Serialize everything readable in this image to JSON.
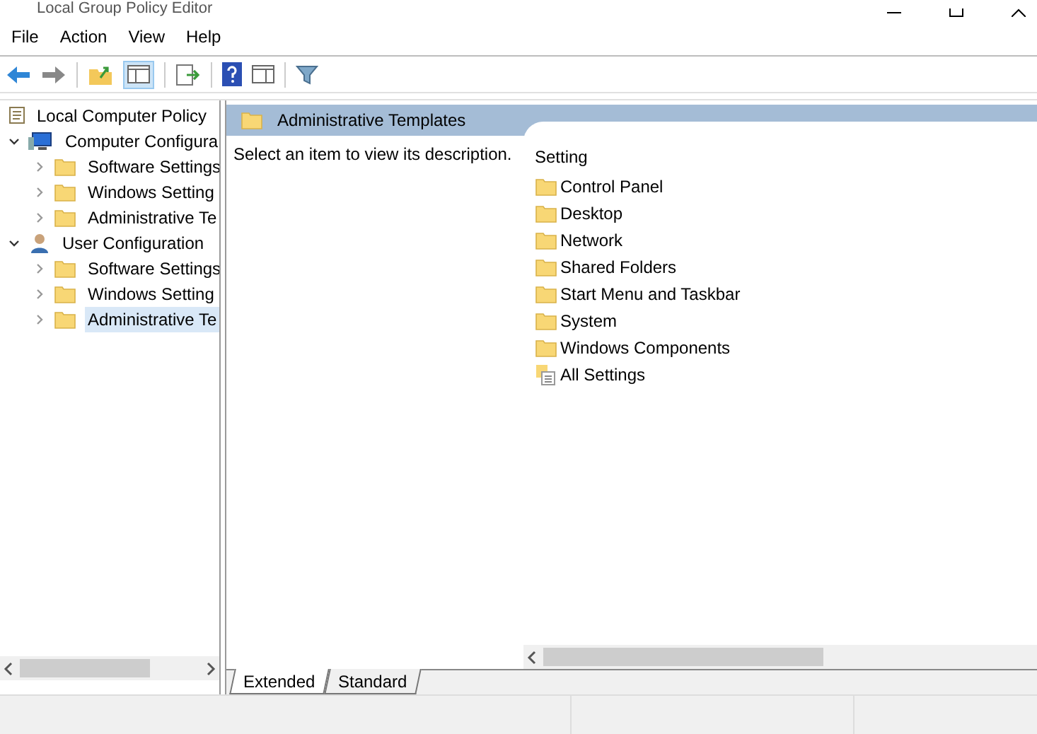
{
  "window": {
    "title": "Local Group Policy Editor"
  },
  "menu": [
    "File",
    "Action",
    "View",
    "Help"
  ],
  "tree": [
    {
      "label": "Local Computer Policy",
      "kind": "policy",
      "selected": false,
      "children": [
        {
          "label": "Computer Configura",
          "kind": "computer",
          "expanded": true,
          "selected": false,
          "children": [
            {
              "label": "Software Settings",
              "kind": "folder",
              "expanded": false,
              "selected": false
            },
            {
              "label": "Windows Setting",
              "kind": "folder",
              "expanded": false,
              "selected": false
            },
            {
              "label": "Administrative Te",
              "kind": "folder",
              "expanded": false,
              "selected": false
            }
          ]
        },
        {
          "label": "User Configuration",
          "kind": "user",
          "expanded": true,
          "selected": false,
          "children": [
            {
              "label": "Software Settings",
              "kind": "folder",
              "expanded": false,
              "selected": false
            },
            {
              "label": "Windows Setting",
              "kind": "folder",
              "expanded": false,
              "selected": false
            },
            {
              "label": "Administrative Te",
              "kind": "folder",
              "expanded": false,
              "selected": true
            }
          ]
        }
      ]
    }
  ],
  "header": {
    "title": "Administrative Templates"
  },
  "description": "Select an item to view its description.",
  "list": {
    "column": "Setting",
    "items": [
      {
        "label": "Control Panel",
        "kind": "folder"
      },
      {
        "label": "Desktop",
        "kind": "folder"
      },
      {
        "label": "Network",
        "kind": "folder"
      },
      {
        "label": "Shared Folders",
        "kind": "folder"
      },
      {
        "label": "Start Menu and Taskbar",
        "kind": "folder"
      },
      {
        "label": "System",
        "kind": "folder"
      },
      {
        "label": "Windows Components",
        "kind": "folder"
      },
      {
        "label": "All Settings",
        "kind": "settings"
      }
    ]
  },
  "tabs": [
    {
      "label": "Extended",
      "selected": true
    },
    {
      "label": "Standard",
      "selected": false
    }
  ]
}
